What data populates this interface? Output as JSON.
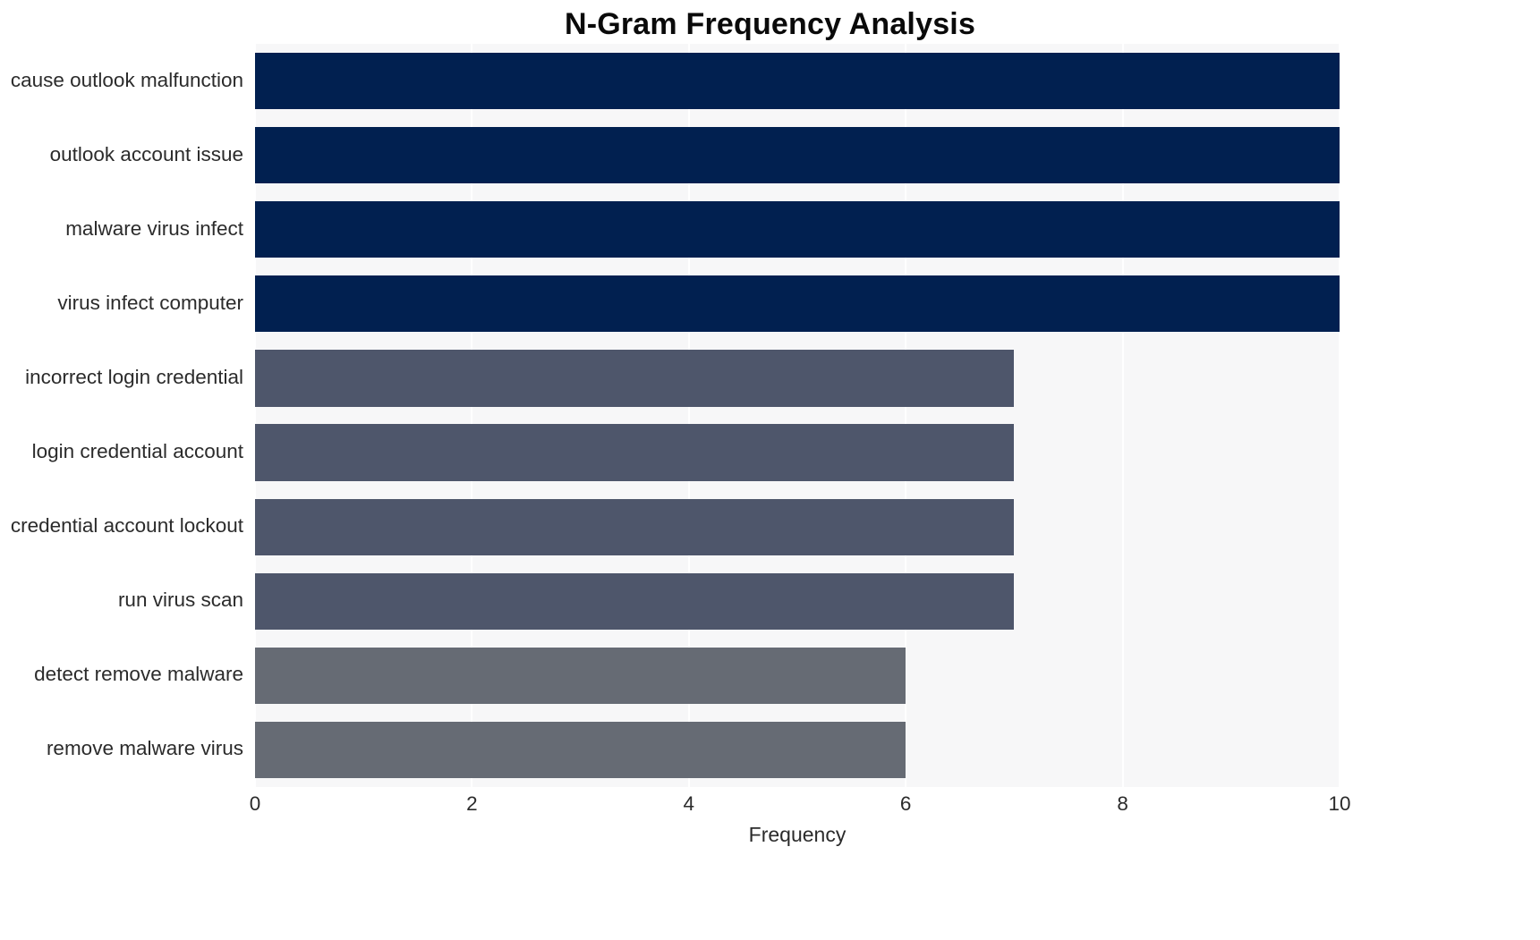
{
  "chart_data": {
    "type": "bar",
    "orientation": "horizontal",
    "title": "N-Gram Frequency Analysis",
    "xlabel": "Frequency",
    "ylabel": "",
    "xlim": [
      0,
      10
    ],
    "xticks": [
      0,
      2,
      4,
      6,
      8,
      10
    ],
    "xtick_labels": [
      "0",
      "2",
      "4",
      "6",
      "8",
      "10"
    ],
    "grid": true,
    "grid_color": "#ffffff",
    "plot_background": "#f7f7f8",
    "legend": null,
    "categories": [
      "cause outlook malfunction",
      "outlook account issue",
      "malware virus infect",
      "virus infect computer",
      "incorrect login credential",
      "login credential account",
      "credential account lockout",
      "run virus scan",
      "detect remove malware",
      "remove malware virus"
    ],
    "values": [
      10,
      10,
      10,
      10,
      7,
      7,
      7,
      7,
      6,
      6
    ],
    "bar_colors": [
      "#012050",
      "#012050",
      "#012050",
      "#012050",
      "#4e566b",
      "#4e566b",
      "#4e566b",
      "#4e566b",
      "#666b74",
      "#666b74"
    ]
  }
}
